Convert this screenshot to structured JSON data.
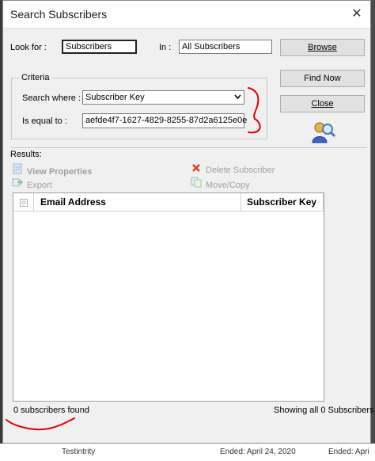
{
  "dialog": {
    "title": "Search Subscribers"
  },
  "look_for": {
    "label": "Look for :",
    "value": "Subscribers"
  },
  "in": {
    "label": "In :",
    "value": "All Subscribers"
  },
  "buttons": {
    "browse": "Browse",
    "find_now": "Find Now",
    "close": "Close"
  },
  "criteria": {
    "legend": "Criteria",
    "search_where_label": "Search where :",
    "search_where_value": "Subscriber Key",
    "is_equal_label": "Is equal to :",
    "is_equal_value": "aefde4f7-1627-4829-8255-87d2a6125e0e"
  },
  "results": {
    "label": "Results:",
    "actions": {
      "view_properties": "View Properties",
      "export": "Export",
      "delete_subscriber": "Delete Subscriber",
      "move_copy": "Move/Copy"
    },
    "columns": [
      "Email Address",
      "Subscriber Key"
    ],
    "rows": []
  },
  "status": {
    "count": "0 subscribers found",
    "showing": "Showing all 0 Subscribers"
  },
  "background": {
    "left_text": "Testintrity",
    "right_text": "Ended: April 24, 2020",
    "far_right": "Ended: Apri"
  },
  "colors": {
    "annotation": "#e00000",
    "dialog_bg": "#f0f0f0",
    "disabled_text": "#a0a0a0"
  },
  "icons": [
    "close-icon",
    "dropdown-arrow-icon",
    "search-people-icon",
    "view-properties-icon",
    "export-icon",
    "delete-icon",
    "move-copy-icon",
    "select-all-icon"
  ]
}
